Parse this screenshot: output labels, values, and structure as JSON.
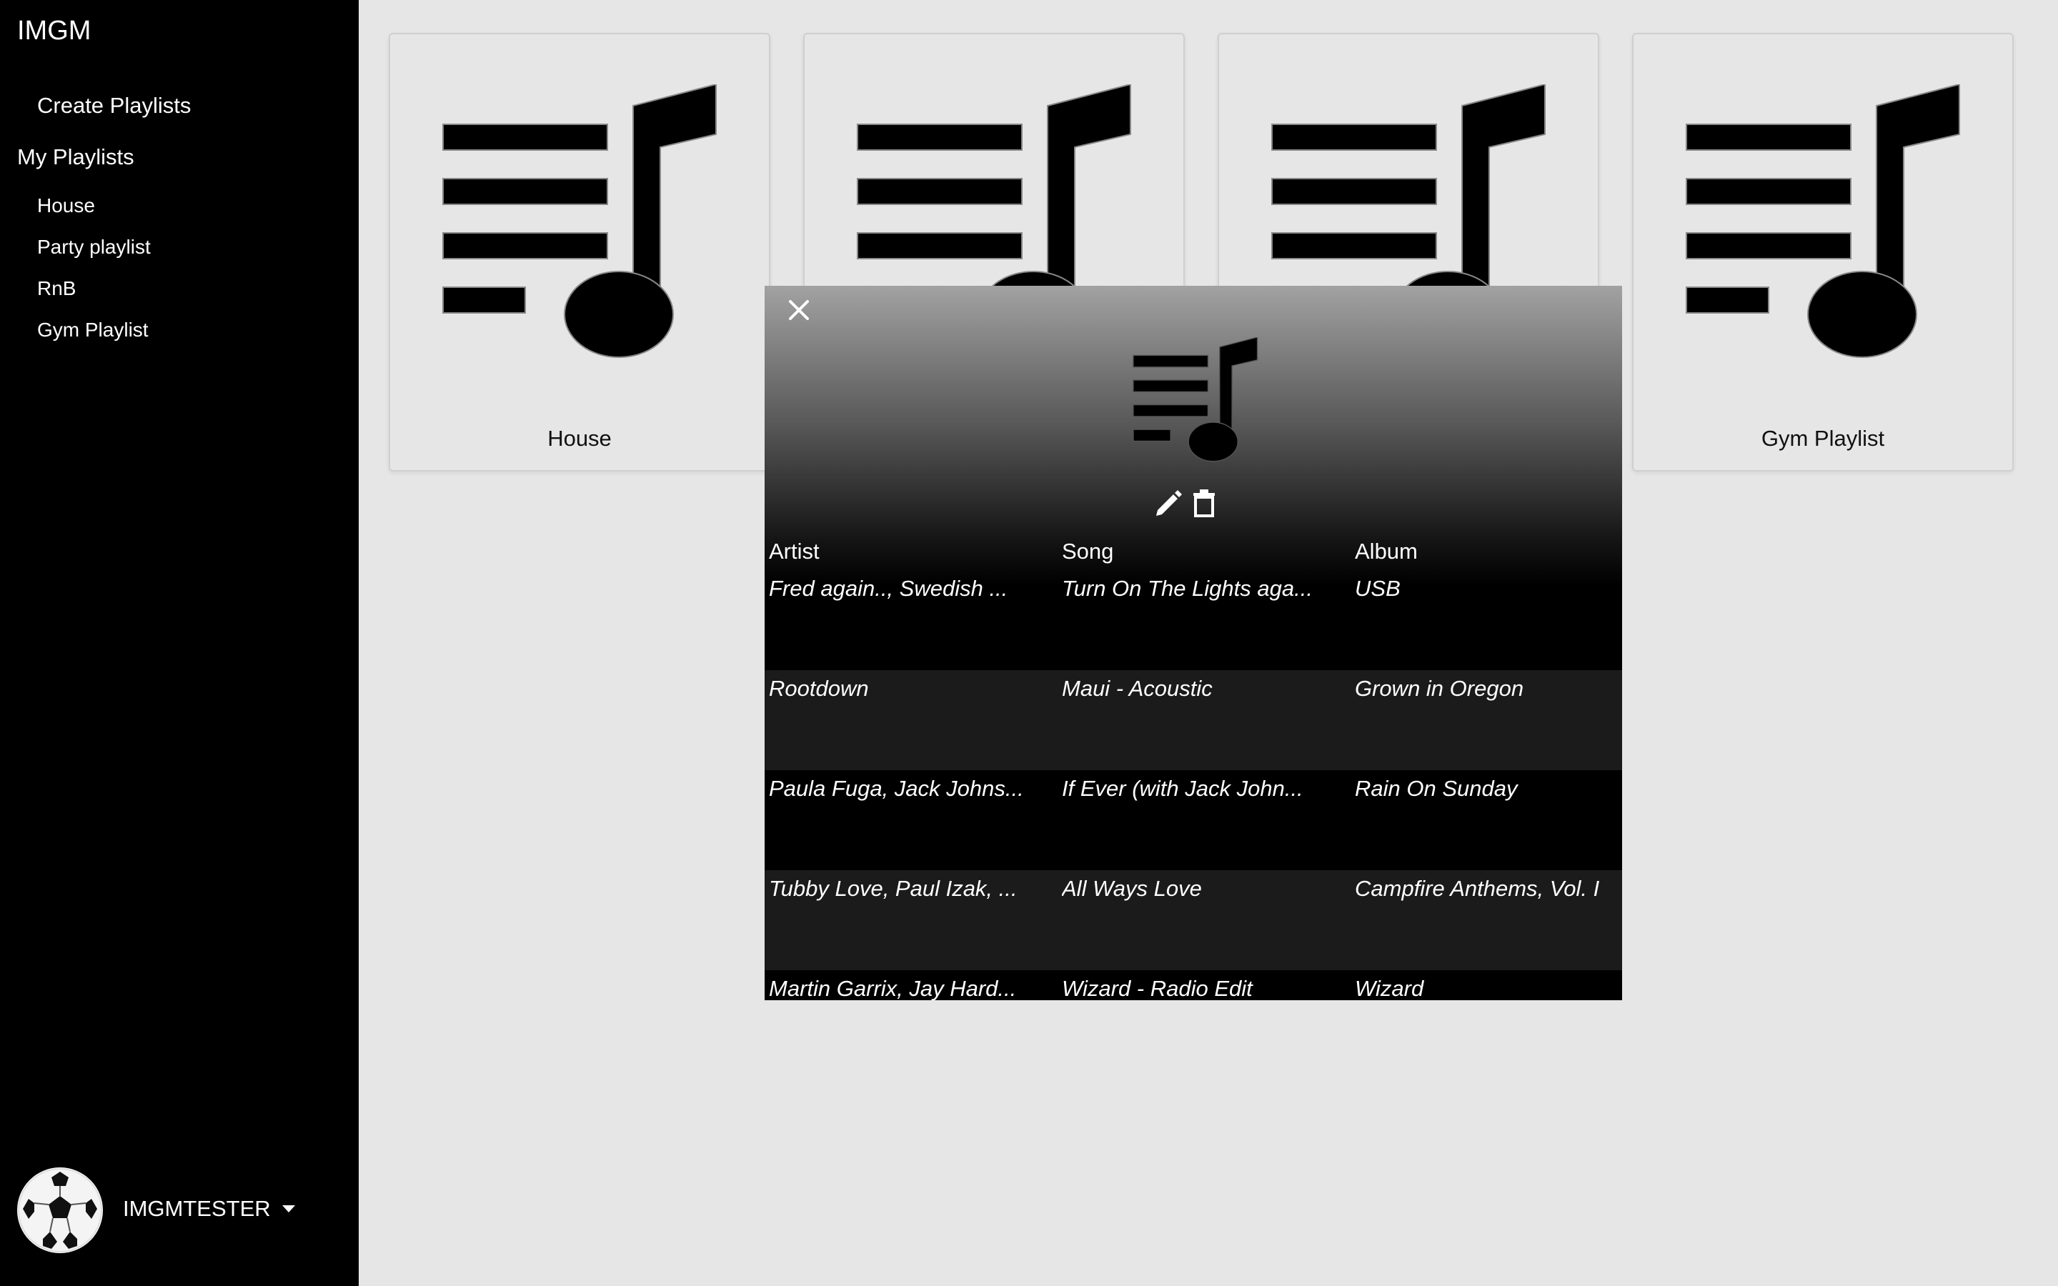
{
  "app": {
    "title": "IMGM"
  },
  "sidebar": {
    "create_label": "Create Playlists",
    "my_playlists_label": "My Playlists",
    "playlists": [
      "House",
      "Party playlist",
      "RnB",
      "Gym Playlist"
    ],
    "user": {
      "name": "IMGMTESTER",
      "avatar_icon": "soccer-ball-icon"
    }
  },
  "cards": [
    {
      "title": "House",
      "icon": "playlist-music-icon"
    },
    {
      "title": "",
      "icon": "playlist-music-icon"
    },
    {
      "title": "",
      "icon": "playlist-music-icon"
    },
    {
      "title": "Gym Playlist",
      "icon": "playlist-music-icon"
    }
  ],
  "modal": {
    "close_icon": "close-icon",
    "edit_icon": "pencil-icon",
    "delete_icon": "trash-icon",
    "columns": [
      "Artist",
      "Song",
      "Album"
    ],
    "rows": [
      {
        "artist": "Fred again.., Swedish ...",
        "song": "Turn On The Lights aga...",
        "album": "USB"
      },
      {
        "artist": "Rootdown",
        "song": "Maui - Acoustic",
        "album": "Grown in Oregon"
      },
      {
        "artist": "Paula Fuga, Jack Johns...",
        "song": "If Ever (with Jack John...",
        "album": "Rain On Sunday"
      },
      {
        "artist": "Tubby Love, Paul Izak, ...",
        "song": "All Ways Love",
        "album": "Campfire Anthems, Vol. I"
      },
      {
        "artist": "Martin Garrix, Jay Hard...",
        "song": "Wizard - Radio Edit",
        "album": "Wizard"
      }
    ]
  },
  "colors": {
    "sidebar_bg": "#000000",
    "main_bg": "#e6e6e6",
    "modal_bg": "#000000",
    "row_alt_bg": "#1b1b1b"
  }
}
